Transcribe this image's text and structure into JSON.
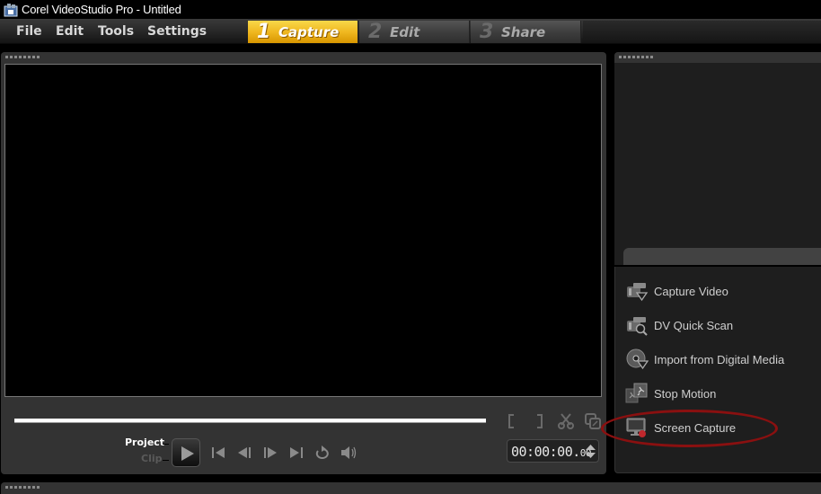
{
  "window": {
    "title": "Corel VideoStudio Pro - Untitled",
    "app_icon": "videostudio-app-icon"
  },
  "menu": {
    "items": [
      {
        "label": "File"
      },
      {
        "label": "Edit"
      },
      {
        "label": "Tools"
      },
      {
        "label": "Settings"
      }
    ]
  },
  "steps": [
    {
      "num": "1",
      "label": "Capture",
      "active": true
    },
    {
      "num": "2",
      "label": "Edit",
      "active": false
    },
    {
      "num": "3",
      "label": "Share",
      "active": false
    }
  ],
  "player": {
    "scrub_position": 0,
    "mode_project_label": "Project",
    "mode_clip_label": "Clip",
    "selected_mode": "Project",
    "edit_icons": [
      "mark-in-icon",
      "mark-out-icon",
      "split-clip-icon",
      "enlarge-preview-icon"
    ],
    "transport_icons": [
      "home-icon",
      "previous-frame-icon",
      "next-frame-icon",
      "end-icon",
      "repeat-icon",
      "volume-icon"
    ],
    "timecode": {
      "main": "00:00:00.",
      "frames": "00"
    }
  },
  "capture_options": [
    {
      "label": "Capture Video",
      "icon": "camcorder-capture-icon"
    },
    {
      "label": "DV Quick Scan",
      "icon": "camcorder-scan-icon"
    },
    {
      "label": "Import from Digital Media",
      "icon": "disc-import-icon"
    },
    {
      "label": "Stop Motion",
      "icon": "stop-motion-icon"
    },
    {
      "label": "Screen Capture",
      "icon": "screen-capture-icon",
      "highlighted": true
    }
  ],
  "colors": {
    "active_step": "#f0b820",
    "highlight_ellipse": "#8a1010",
    "panel_bg": "#333333",
    "list_bg": "#1e1e1e"
  }
}
